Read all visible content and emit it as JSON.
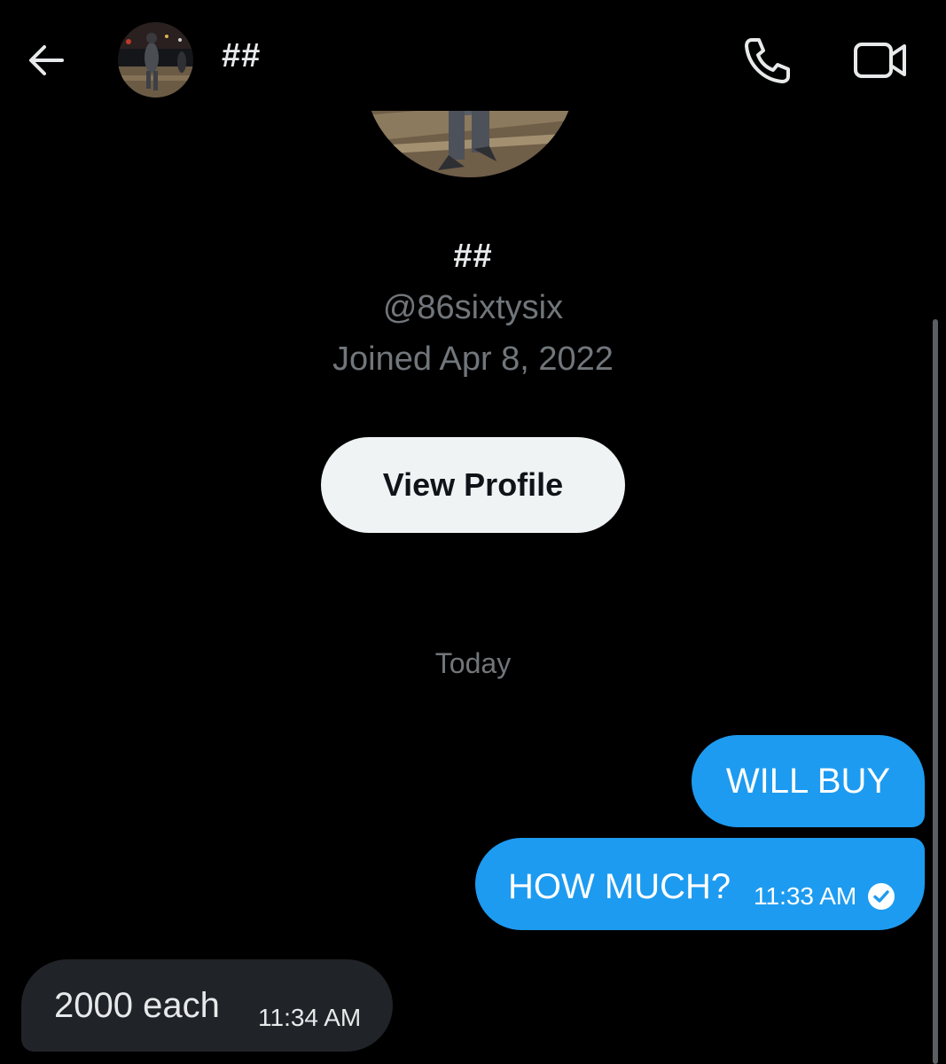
{
  "header": {
    "back_icon": "arrow-left-icon",
    "title": "##",
    "call_icon": "phone-icon",
    "video_icon": "video-camera-icon"
  },
  "profile": {
    "name": "##",
    "handle": "@86sixtysix",
    "joined": "Joined Apr 8, 2022",
    "view_profile_label": "View Profile"
  },
  "conversation": {
    "date_divider": "Today",
    "messages": [
      {
        "direction": "sent",
        "text": "WILL BUY",
        "time": ""
      },
      {
        "direction": "sent",
        "text": "HOW MUCH?",
        "time": "11:33 AM",
        "status_icon": "read-check-icon"
      },
      {
        "direction": "received",
        "text": "2000 each",
        "time": "11:34 AM"
      }
    ]
  },
  "colors": {
    "background": "#000000",
    "sent_bubble": "#1d9bf0",
    "received_bubble": "#202327",
    "secondary_text": "#71767b",
    "button_bg": "#eff3f4"
  }
}
